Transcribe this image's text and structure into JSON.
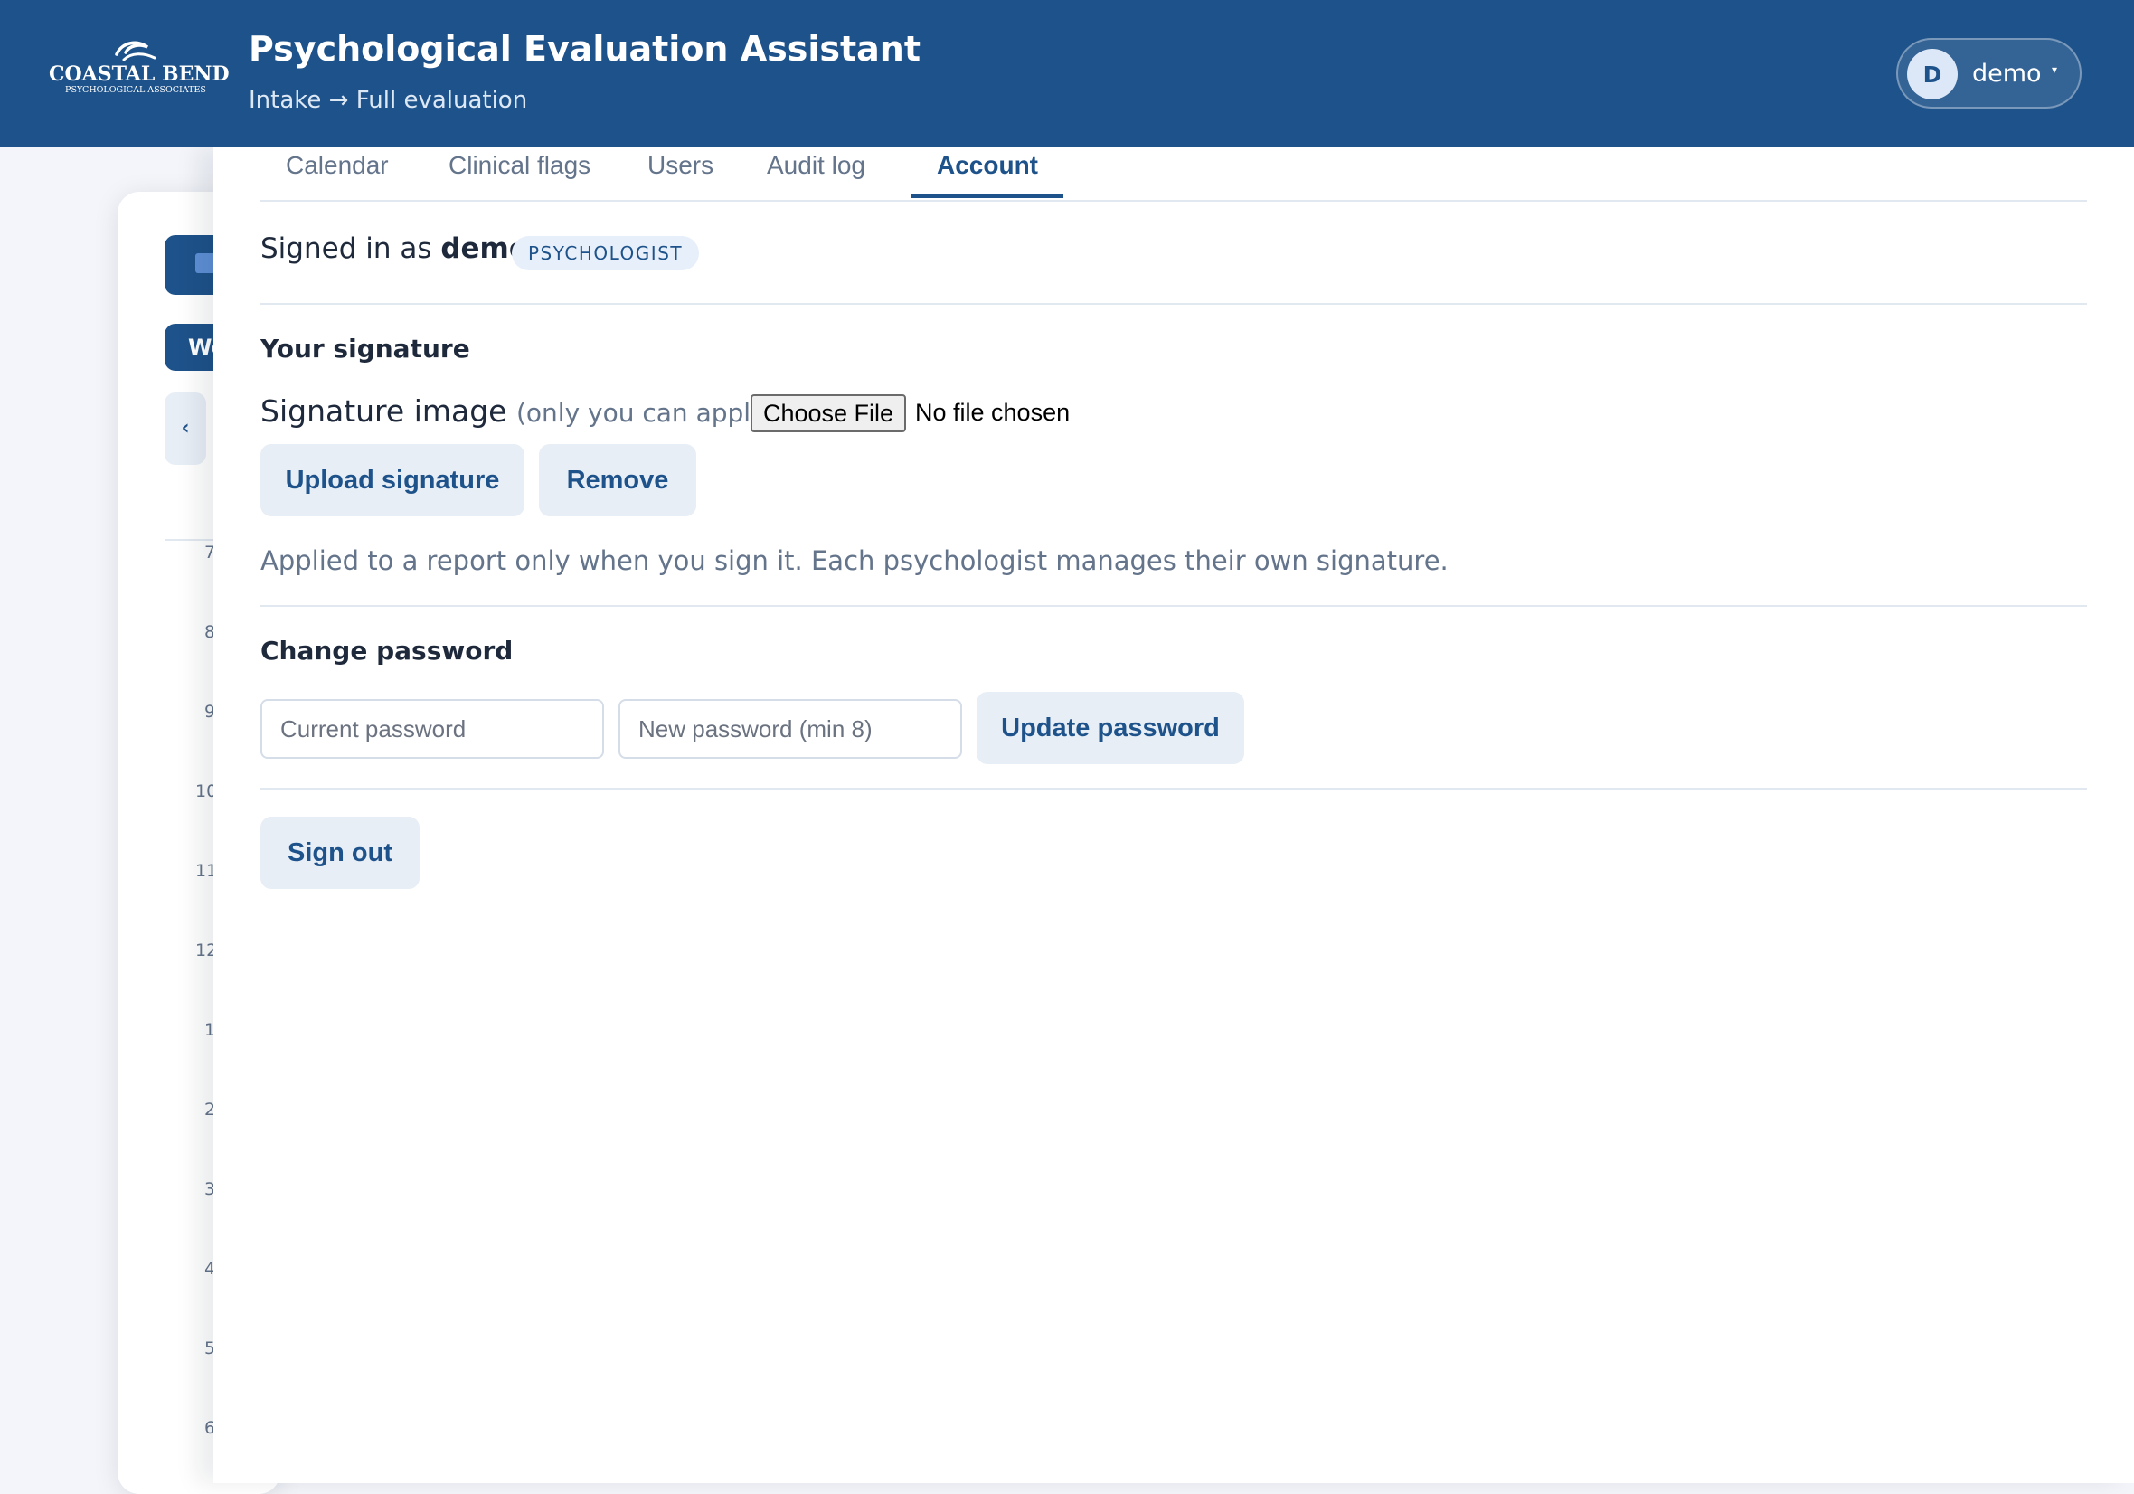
{
  "header": {
    "logo_name": "COASTAL BEND",
    "logo_sub": "PSYCHOLOGICAL ASSOCIATES",
    "title": "Psychological Evaluation Assistant",
    "subtitle": "Intake → Full evaluation",
    "user": {
      "initial": "D",
      "name": "demo",
      "caret": "▾"
    }
  },
  "background": {
    "week_label": "We",
    "prev_label": "‹",
    "hours": [
      "7",
      "8",
      "9",
      "10",
      "11",
      "12",
      "1",
      "2",
      "3",
      "4",
      "5",
      "6"
    ]
  },
  "tabs": [
    {
      "label": "Calendar",
      "active": false
    },
    {
      "label": "Clinical flags",
      "active": false
    },
    {
      "label": "Users",
      "active": false
    },
    {
      "label": "Audit log",
      "active": false
    },
    {
      "label": "Account",
      "active": true
    }
  ],
  "account": {
    "signed_in_prefix": "Signed in as",
    "username": "demo",
    "role": "PSYCHOLOGIST",
    "signature": {
      "title": "Your signature",
      "label": "Signature image",
      "hint": "(only you can apply it)",
      "file_button": "Choose File",
      "file_status": "No file chosen",
      "upload_button": "Upload signature",
      "remove_button": "Remove",
      "help": "Applied to a report only when you sign it. Each psychologist manages their own signature."
    },
    "password": {
      "title": "Change password",
      "current_placeholder": "Current password",
      "new_placeholder": "New password (min 8)",
      "update_button": "Update password"
    },
    "sign_out_button": "Sign out"
  },
  "colors": {
    "brand": "#1e528a",
    "button_bg": "#e8eef6",
    "muted_text": "#64748b"
  }
}
